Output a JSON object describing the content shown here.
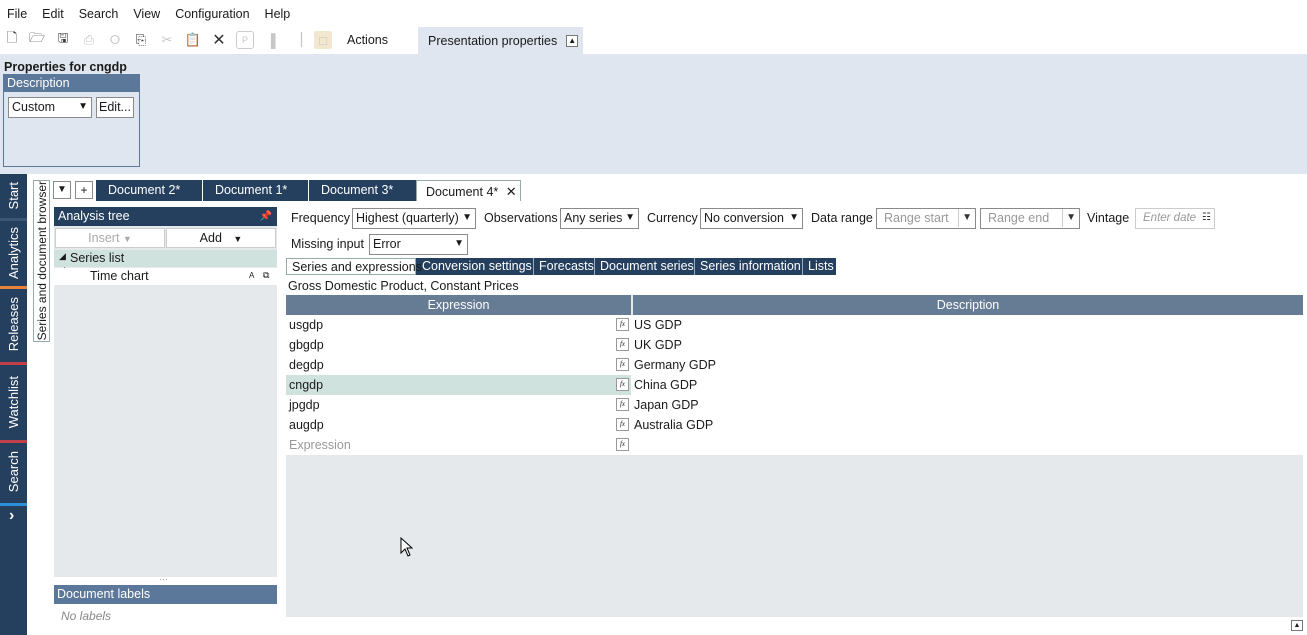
{
  "menu": [
    "File",
    "Edit",
    "Search",
    "View",
    "Configuration",
    "Help"
  ],
  "toolbar": {
    "actions_label": "Actions",
    "presentation_tab": "Presentation properties"
  },
  "properties": {
    "title": "Properties for cngdp",
    "description_header": "Description",
    "description_value": "Custom",
    "edit_button": "Edit..."
  },
  "sidebar": {
    "tabs": [
      "Start",
      "Analytics",
      "Releases",
      "Watchlist",
      "Search"
    ],
    "expand_glyph": "›"
  },
  "browser_tab": "Series and document browser",
  "document_tabs": [
    "Document 2*",
    "Document 1*",
    "Document 3*",
    "Document 4*"
  ],
  "analysis_tree": {
    "header": "Analysis tree",
    "insert_label": "Insert",
    "add_label": "Add",
    "series_list": "Series list",
    "time_chart": "Time chart"
  },
  "document_labels": {
    "header": "Document labels",
    "placeholder": "No labels"
  },
  "controls": {
    "frequency_label": "Frequency",
    "frequency_value": "Highest (quarterly)",
    "observations_label": "Observations",
    "observations_value": "Any series",
    "currency_label": "Currency",
    "currency_value": "No conversion",
    "data_range_label": "Data range",
    "range_start": "Range start",
    "range_end": "Range end",
    "vintage_label": "Vintage",
    "vintage_placeholder": "Enter date",
    "missing_label": "Missing input",
    "missing_value": "Error"
  },
  "subtabs": [
    "Series and expressions",
    "Conversion settings",
    "Forecasts",
    "Document series",
    "Series information",
    "Lists"
  ],
  "doc_title": "Gross Domestic Product, Constant Prices",
  "grid": {
    "col_expression": "Expression",
    "col_description": "Description",
    "rows": [
      {
        "expr": "usgdp",
        "desc": "US GDP"
      },
      {
        "expr": "gbgdp",
        "desc": "UK GDP"
      },
      {
        "expr": "degdp",
        "desc": "Germany GDP"
      },
      {
        "expr": "cngdp",
        "desc": "China GDP"
      },
      {
        "expr": "jpgdp",
        "desc": "Japan GDP"
      },
      {
        "expr": "augdp",
        "desc": "Australia GDP"
      }
    ],
    "new_placeholder": "Expression",
    "fx_label": "fx",
    "selected_row": 3
  },
  "colors": {
    "navy": "#253f5e",
    "steel": "#5b7799",
    "panel": "#dfe6ef",
    "selection": "#d0e2de",
    "accent_orange": "#e8833a"
  }
}
